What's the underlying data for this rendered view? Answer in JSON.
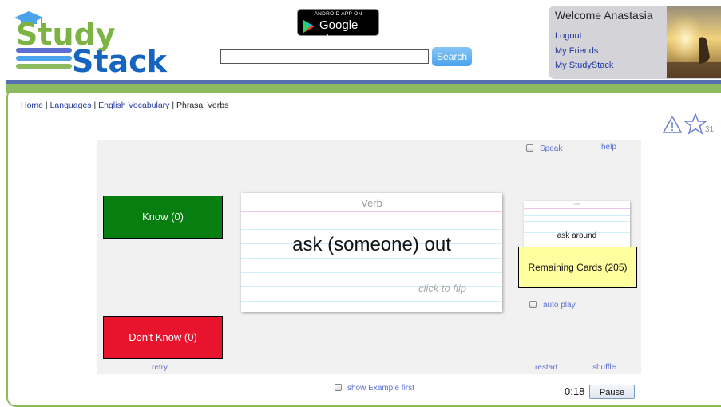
{
  "header": {
    "logo_top": "Study",
    "logo_bottom": "Stack",
    "google_play_small": "ANDROID APP ON",
    "google_play_big": "Google play",
    "search_value": "",
    "search_button": "Search"
  },
  "user": {
    "welcome": "Welcome Anastasia",
    "links": [
      "Logout",
      "My Friends",
      "My StudyStack"
    ]
  },
  "breadcrumb": {
    "home": "Home",
    "sep": " | ",
    "languages": "Languages",
    "english_vocab": "English Vocabulary",
    "current": "Phrasal Verbs"
  },
  "toolbar": {
    "star_count": "31"
  },
  "study": {
    "speak": "Speak",
    "help": "help",
    "know_button": "Know (0)",
    "dont_know_button": "Don't Know (0)",
    "card_category": "Verb",
    "card_term": "ask (someone) out",
    "click_to_flip": "click to flip",
    "next_card_category": "Verb",
    "next_card_term": "ask around",
    "remaining": "Remaining Cards (205)",
    "auto_play": "auto play",
    "retry": "retry",
    "restart": "restart",
    "shuffle": "shuffle",
    "show_example_first": "show Example first",
    "timer": "0:18",
    "pause_button": "Pause"
  },
  "colors": {
    "know": "#067f10",
    "dont_know": "#e8142e",
    "remaining_bg": "#ffffa0",
    "band_blue": "#556fb0",
    "band_green": "#8bbb5e"
  }
}
